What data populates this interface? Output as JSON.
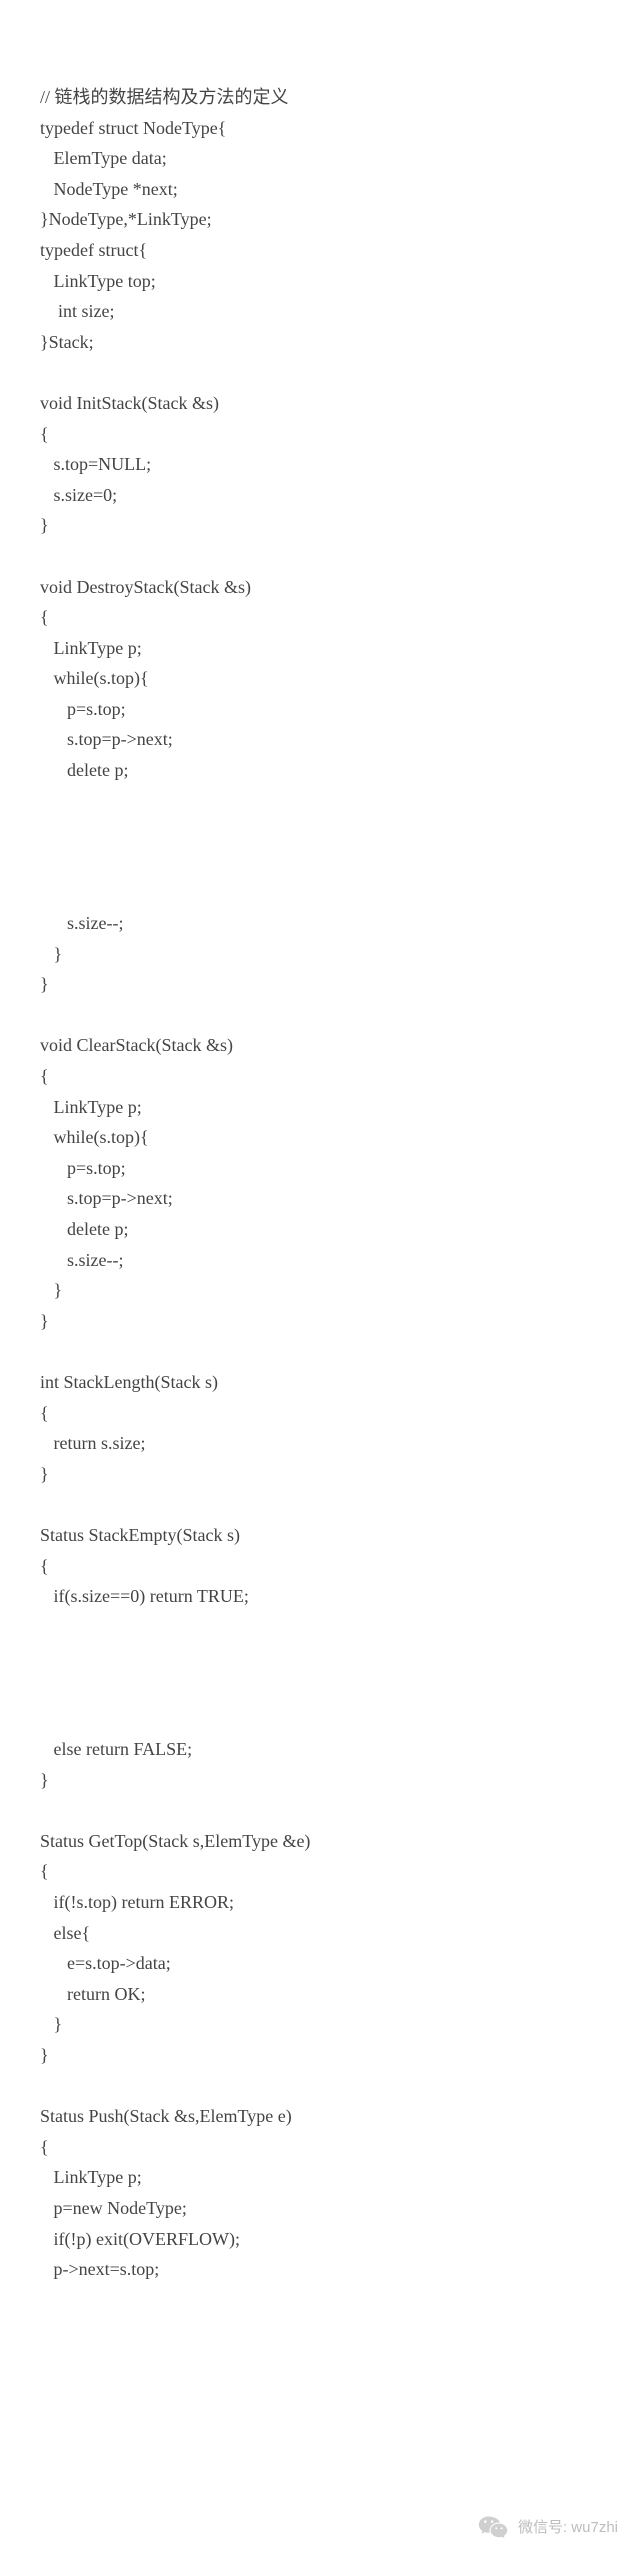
{
  "code": {
    "text": "// 链栈的数据结构及方法的定义\ntypedef struct NodeType{\n   ElemType data;\n   NodeType *next;\n}NodeType,*LinkType;\ntypedef struct{\n   LinkType top;\n    int size;\n}Stack;\n\nvoid InitStack(Stack &s)\n{\n   s.top=NULL;\n   s.size=0;\n}\n\nvoid DestroyStack(Stack &s)\n{\n   LinkType p;\n   while(s.top){\n      p=s.top;\n      s.top=p->next;\n      delete p;\n\n\n\n\n      s.size--;\n   }\n}\n\nvoid ClearStack(Stack &s)\n{\n   LinkType p;\n   while(s.top){\n      p=s.top;\n      s.top=p->next;\n      delete p;\n      s.size--;\n   }\n}\n\nint StackLength(Stack s)\n{\n   return s.size;\n}\n\nStatus StackEmpty(Stack s)\n{\n   if(s.size==0) return TRUE;\n\n\n\n\n   else return FALSE;\n}\n\nStatus GetTop(Stack s,ElemType &e)\n{\n   if(!s.top) return ERROR;\n   else{\n      e=s.top->data;\n      return OK;\n   }\n}\n\nStatus Push(Stack &s,ElemType e)\n{\n   LinkType p;\n   p=new NodeType;\n   if(!p) exit(OVERFLOW);\n   p->next=s.top;"
  },
  "footer": {
    "prefix": "微信号:",
    "handle": "wu7zhi"
  }
}
